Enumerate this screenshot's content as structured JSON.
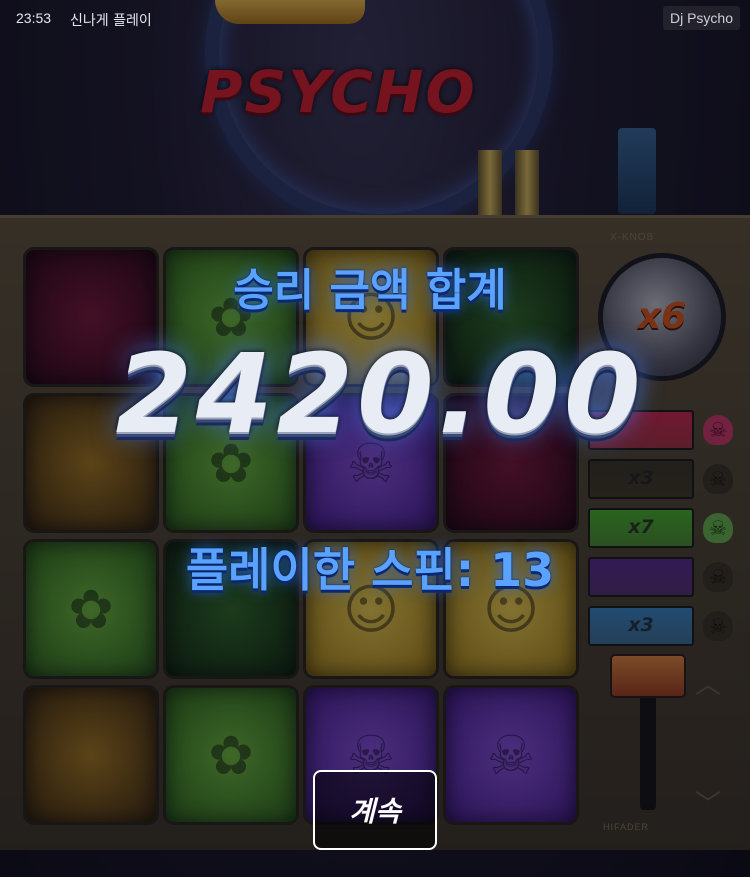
{
  "status_bar": {
    "time": "23:53",
    "title": "신나게 플레이",
    "game_name": "Dj Psycho"
  },
  "logo": {
    "text": "PSYCHO"
  },
  "multiplier_knob": {
    "caption": "X-KNOB",
    "value": "x6"
  },
  "multiplier_rows": [
    {
      "label": "",
      "color": "#d2284a"
    },
    {
      "label": "x3",
      "color": "#3a3520"
    },
    {
      "label": "x7",
      "color": "#4ab82a"
    },
    {
      "label": "",
      "color": "#5a2a90"
    },
    {
      "label": "x3",
      "color": "#3a8ac8"
    }
  ],
  "fader": {
    "caption": "HIFADER"
  },
  "win_summary": {
    "title": "승리 금액 합계",
    "amount": "2420.00",
    "spins_text": "플레이한 스핀:  13"
  },
  "continue_button": {
    "label": "계속"
  },
  "colors": {
    "accent_blue": "#5aa2ff",
    "logo_red": "#d9202a",
    "knob_orange": "#e05a14"
  },
  "pad_icons": [
    "cannabis-icon",
    "smiley-icon",
    "skull-icon"
  ]
}
